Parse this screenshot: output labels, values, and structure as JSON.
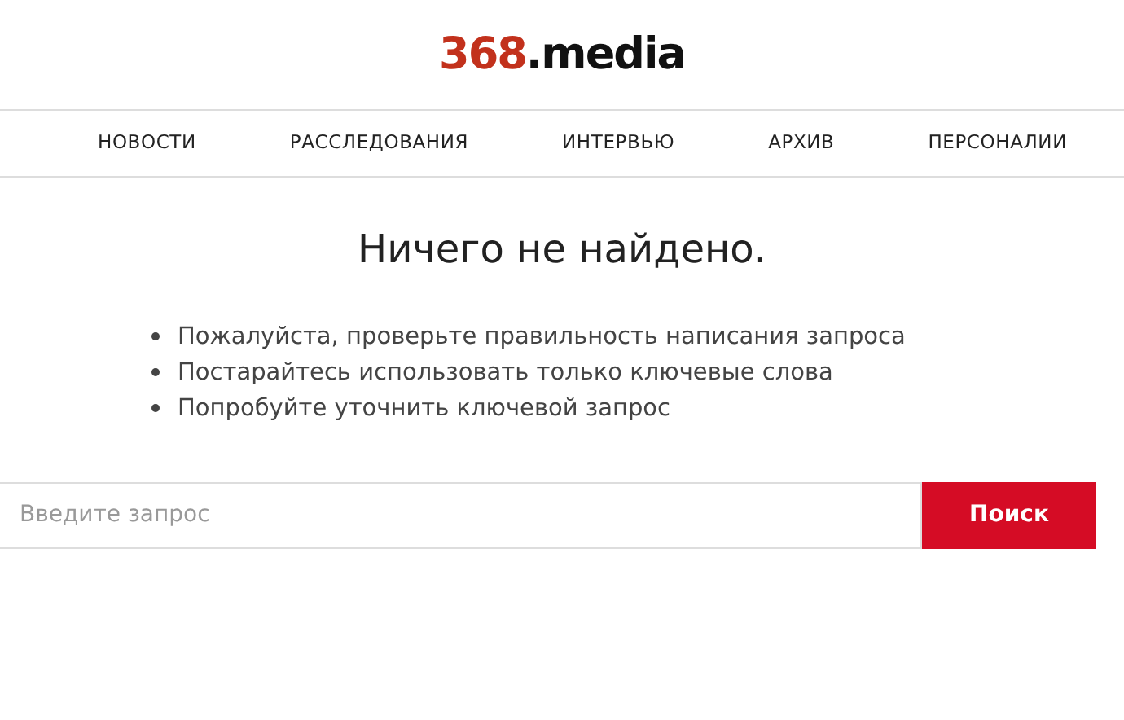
{
  "logo": {
    "number": "368",
    "suffix": ".media"
  },
  "nav": [
    "НОВОСТИ",
    "РАССЛЕДОВАНИЯ",
    "ИНТЕРВЬЮ",
    "АРХИВ",
    "ПЕРСОНАЛИИ"
  ],
  "heading": "Ничего не найдено.",
  "tips": [
    "Пожалуйста, проверьте правильность написания запроса",
    "Постарайтесь использовать только ключевые слова",
    "Попробуйте уточнить ключевой запрос"
  ],
  "search": {
    "placeholder": "Введите запрос",
    "button": "Поиск"
  }
}
